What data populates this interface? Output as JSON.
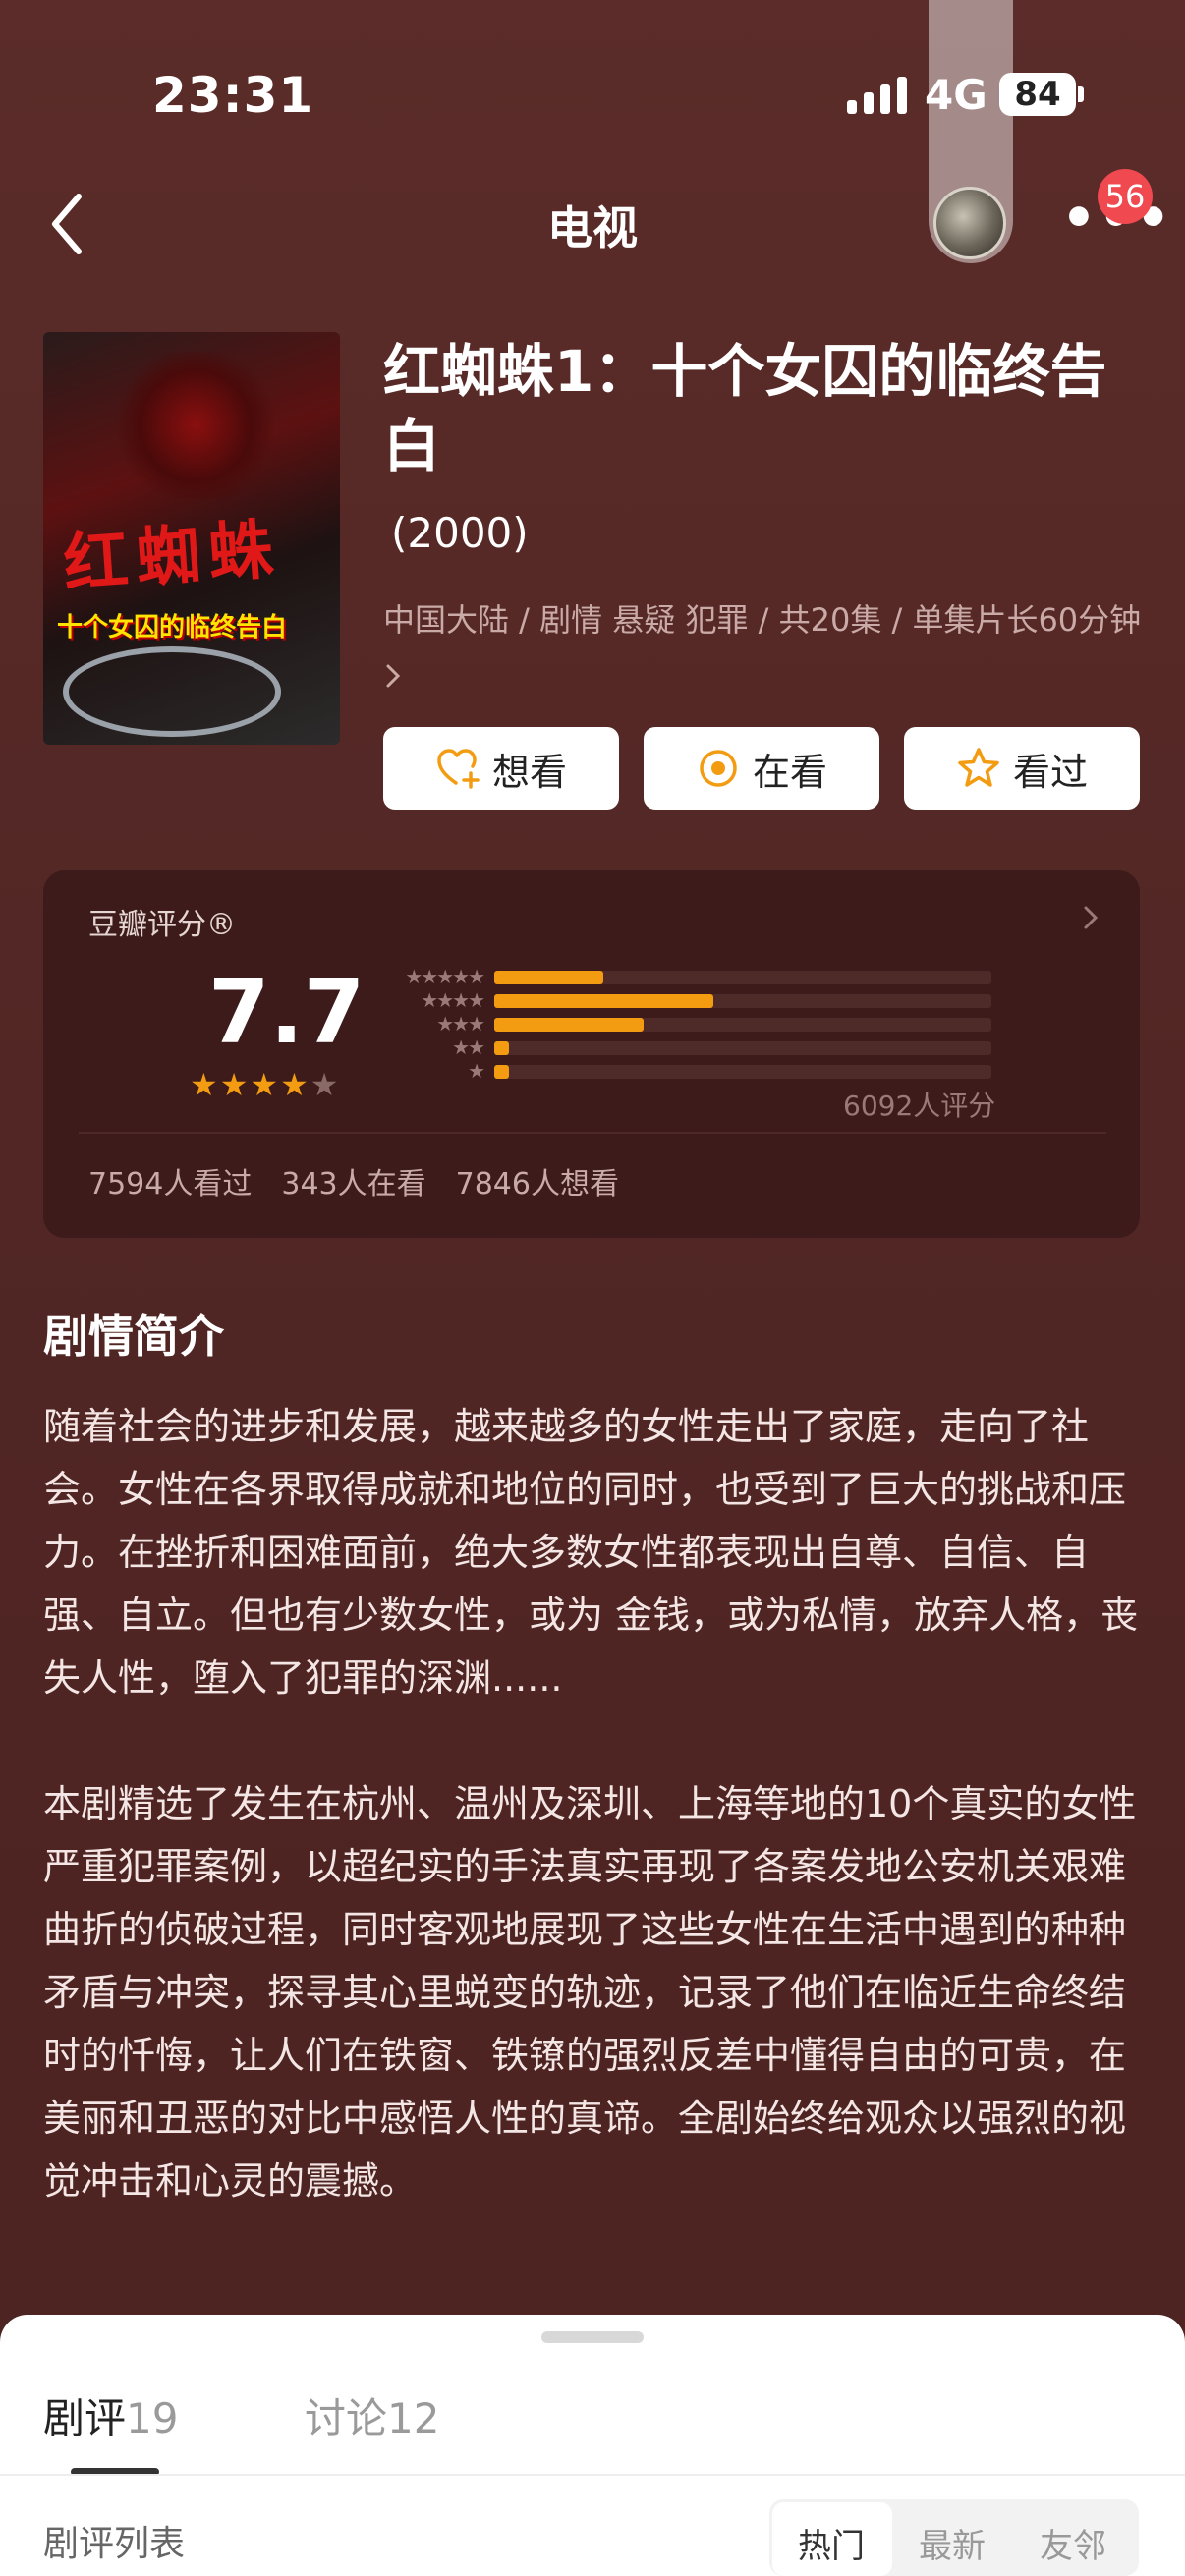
{
  "status_bar": {
    "time": "23:31",
    "network": "4G",
    "battery": "84"
  },
  "header": {
    "title": "电视",
    "notification_count": "56"
  },
  "movie": {
    "title": "红蜘蛛1：十个女囚的临终告白",
    "year": "(2000)",
    "meta": "中国大陆 / 剧情 悬疑 犯罪 / 共20集 / 单集片长60分钟",
    "poster_title": "红蜘蛛",
    "poster_subtitle": "十个女囚的临终告白"
  },
  "actions": {
    "want": "想看",
    "watching": "在看",
    "watched": "看过"
  },
  "rating": {
    "label": "豆瓣评分®",
    "score": "7.7",
    "star_value": 4,
    "distribution": [
      {
        "stars": 5,
        "fraction": 0.22
      },
      {
        "stars": 4,
        "fraction": 0.44
      },
      {
        "stars": 3,
        "fraction": 0.3
      },
      {
        "stars": 2,
        "fraction": 0.03
      },
      {
        "stars": 1,
        "fraction": 0.03
      }
    ],
    "count": "6092人评分",
    "watched": "7594人看过",
    "watching": "343人在看",
    "want": "7846人想看"
  },
  "synopsis": {
    "title": "剧情简介",
    "paragraphs": [
      "随着社会的进步和发展，越来越多的女性走出了家庭，走向了社会。女性在各界取得成就和地位的同时，也受到了巨大的挑战和压力。在挫折和困难面前，绝大多数女性都表现出自尊、自信、自强、自立。但也有少数女性，或为 金钱，或为私情，放弃人格，丧失人性，堕入了犯罪的深渊......",
      "本剧精选了发生在杭州、温州及深圳、上海等地的10个真实的女性严重犯罪案例，以超纪实的手法真实再现了各案发地公安机关艰难曲折的侦破过程，同时客观地展现了这些女性在生活中遇到的种种矛盾与冲突，探寻其心里蜕变的轨迹，记录了他们在临近生命终结时的忏悔，让人们在铁窗、铁镣的强烈反差中懂得自由的可贵，在美丽和丑恶的对比中感悟人性的真谛。全剧始终给观众以强烈的视觉冲击和心灵的震撼。"
    ]
  },
  "sheet": {
    "tabs": [
      {
        "label": "剧评",
        "count": "19"
      },
      {
        "label": "讨论",
        "count": "12"
      }
    ],
    "list_title": "剧评列表",
    "sort_options": [
      "热门",
      "最新",
      "友邻"
    ]
  },
  "colors": {
    "accent": "#f39c12",
    "background": "#552a27",
    "badge": "#f0494f"
  }
}
